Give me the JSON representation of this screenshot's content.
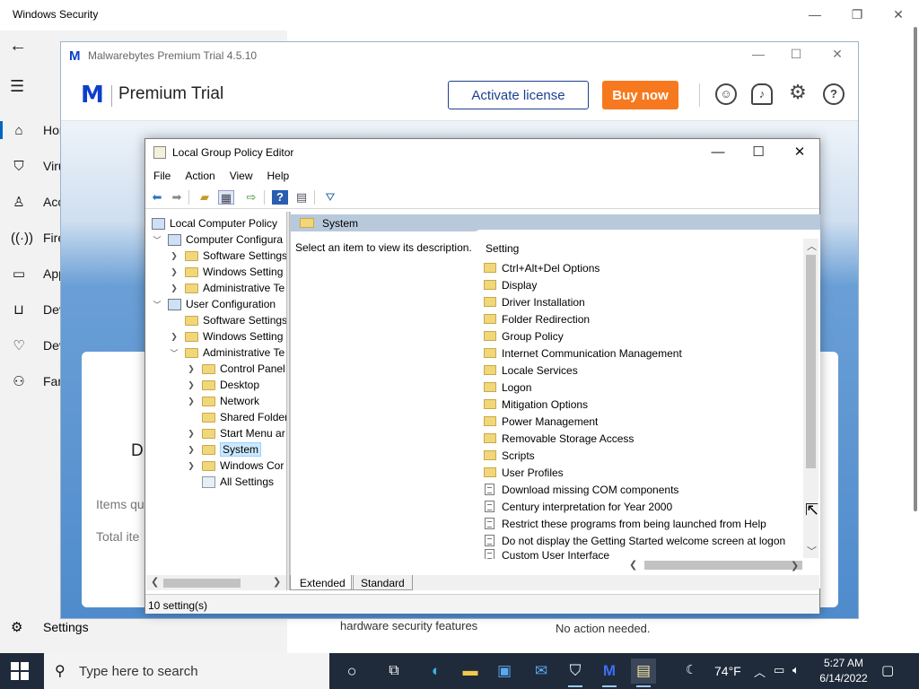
{
  "windows_security": {
    "title": "Windows Security",
    "nav": [
      "Hor",
      "Viru",
      "Acc",
      "Fire",
      "App",
      "Dev",
      "Dev",
      "Fan"
    ],
    "settings_label": "Settings",
    "fragments": {
      "heading_d": "D",
      "items_q": "Items qu",
      "total_ite": "Total ite",
      "hardware": "hardware security features",
      "no_action": "No action needed."
    }
  },
  "malwarebytes": {
    "window_title": "Malwarebytes Premium Trial  4.5.10",
    "product": "Premium Trial",
    "activate_label": "Activate license",
    "buy_label": "Buy now",
    "brand_color": "#0d3ecc",
    "buy_color": "#f7791f"
  },
  "gpedit": {
    "title": "Local Group Policy Editor",
    "menu": [
      "File",
      "Action",
      "View",
      "Help"
    ],
    "tree": [
      {
        "label": "Local Computer Policy",
        "level": 0,
        "expander": "",
        "icon": "pc"
      },
      {
        "label": "Computer Configura",
        "level": 1,
        "expander": "v",
        "icon": "pc"
      },
      {
        "label": "Software Settings",
        "level": 2,
        "expander": ">",
        "icon": "folder"
      },
      {
        "label": "Windows Setting",
        "level": 2,
        "expander": ">",
        "icon": "folder"
      },
      {
        "label": "Administrative Te",
        "level": 2,
        "expander": ">",
        "icon": "folder"
      },
      {
        "label": "User Configuration",
        "level": 1,
        "expander": "v",
        "icon": "pc"
      },
      {
        "label": "Software Settings",
        "level": 2,
        "expander": "",
        "icon": "folder"
      },
      {
        "label": "Windows Setting",
        "level": 2,
        "expander": ">",
        "icon": "folder"
      },
      {
        "label": "Administrative Te",
        "level": 2,
        "expander": "v",
        "icon": "folder"
      },
      {
        "label": "Control Panel",
        "level": 3,
        "expander": ">",
        "icon": "folder"
      },
      {
        "label": "Desktop",
        "level": 3,
        "expander": ">",
        "icon": "folder"
      },
      {
        "label": "Network",
        "level": 3,
        "expander": ">",
        "icon": "folder"
      },
      {
        "label": "Shared Folder",
        "level": 3,
        "expander": "",
        "icon": "folder"
      },
      {
        "label": "Start Menu ar",
        "level": 3,
        "expander": ">",
        "icon": "folder"
      },
      {
        "label": "System",
        "level": 3,
        "expander": ">",
        "icon": "folder",
        "selected": true
      },
      {
        "label": "Windows Cor",
        "level": 3,
        "expander": ">",
        "icon": "folder"
      },
      {
        "label": "All Settings",
        "level": 3,
        "expander": "",
        "icon": "settings"
      }
    ],
    "selected_node": "System",
    "description": "Select an item to view its description.",
    "column_header": "Setting",
    "settings": [
      {
        "label": "Ctrl+Alt+Del Options",
        "type": "folder"
      },
      {
        "label": "Display",
        "type": "folder"
      },
      {
        "label": "Driver Installation",
        "type": "folder"
      },
      {
        "label": "Folder Redirection",
        "type": "folder"
      },
      {
        "label": "Group Policy",
        "type": "folder"
      },
      {
        "label": "Internet Communication Management",
        "type": "folder"
      },
      {
        "label": "Locale Services",
        "type": "folder"
      },
      {
        "label": "Logon",
        "type": "folder"
      },
      {
        "label": "Mitigation Options",
        "type": "folder"
      },
      {
        "label": "Power Management",
        "type": "folder"
      },
      {
        "label": "Removable Storage Access",
        "type": "folder"
      },
      {
        "label": "Scripts",
        "type": "folder"
      },
      {
        "label": "User Profiles",
        "type": "folder"
      },
      {
        "label": "Download missing COM components",
        "type": "policy"
      },
      {
        "label": "Century interpretation for Year 2000",
        "type": "policy"
      },
      {
        "label": "Restrict these programs from being launched from Help",
        "type": "policy"
      },
      {
        "label": "Do not display the Getting Started welcome screen at logon",
        "type": "policy"
      },
      {
        "label": "Custom User Interface",
        "type": "policy"
      }
    ],
    "tabs": [
      "Extended",
      "Standard"
    ],
    "active_tab": "Extended",
    "status": "10 setting(s)"
  },
  "taskbar": {
    "search_placeholder": "Type here to search",
    "temperature": "74°F",
    "time": "5:27 AM",
    "date": "6/14/2022",
    "apps": [
      "task-view",
      "edge",
      "file-explorer",
      "store",
      "mail",
      "security",
      "malwarebytes",
      "notepad"
    ]
  }
}
